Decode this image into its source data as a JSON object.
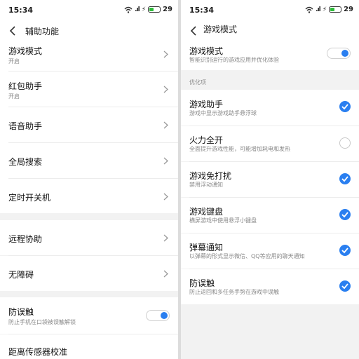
{
  "left": {
    "status": {
      "time": "15:34",
      "battery": "29"
    },
    "header": {
      "title": "辅助功能"
    },
    "items": [
      {
        "title": "游戏模式",
        "subtitle": "开启"
      },
      {
        "title": "红包助手",
        "subtitle": "开启"
      },
      {
        "title": "语音助手"
      },
      {
        "title": "全局搜索"
      },
      {
        "title": "定时开关机"
      },
      {
        "title": "远程协助"
      },
      {
        "title": "无障碍"
      },
      {
        "title": "防误触",
        "subtitle": "防止手机在口袋被误触解锁",
        "toggle": true
      },
      {
        "title": "距离传感器校准"
      }
    ]
  },
  "right": {
    "status": {
      "time": "15:34",
      "battery": "29"
    },
    "header": {
      "title": "游戏模式"
    },
    "main_toggle": {
      "title": "游戏模式",
      "subtitle": "智能识别运行的游戏应用并优化体验",
      "on": true
    },
    "section_label": "优化项",
    "options": [
      {
        "title": "游戏助手",
        "subtitle": "游戏中显示游戏助手悬浮球",
        "checked": true
      },
      {
        "title": "火力全开",
        "subtitle": "全面提升游戏性能，可能增加耗电和发热",
        "checked": false
      },
      {
        "title": "游戏免打扰",
        "subtitle": "禁用浮动通知",
        "checked": true
      },
      {
        "title": "游戏键盘",
        "subtitle": "横屏游戏中使用悬浮小键盘",
        "checked": true
      },
      {
        "title": "弹幕通知",
        "subtitle": "以弹幕的形式显示微信、QQ等应用的聊天通知",
        "checked": true
      },
      {
        "title": "防误触",
        "subtitle": "防止返回和多任务手势在游戏中误触",
        "checked": true
      }
    ]
  },
  "colors": {
    "accent": "#2a7ff0",
    "background": "#f2f2f2",
    "battery": "#2dbd3a"
  },
  "icons": {
    "back": "back-arrow-icon",
    "chevron": "chevron-right-icon",
    "check": "check-circle-icon",
    "wifi": "wifi-icon",
    "signal": "signal-icon"
  }
}
